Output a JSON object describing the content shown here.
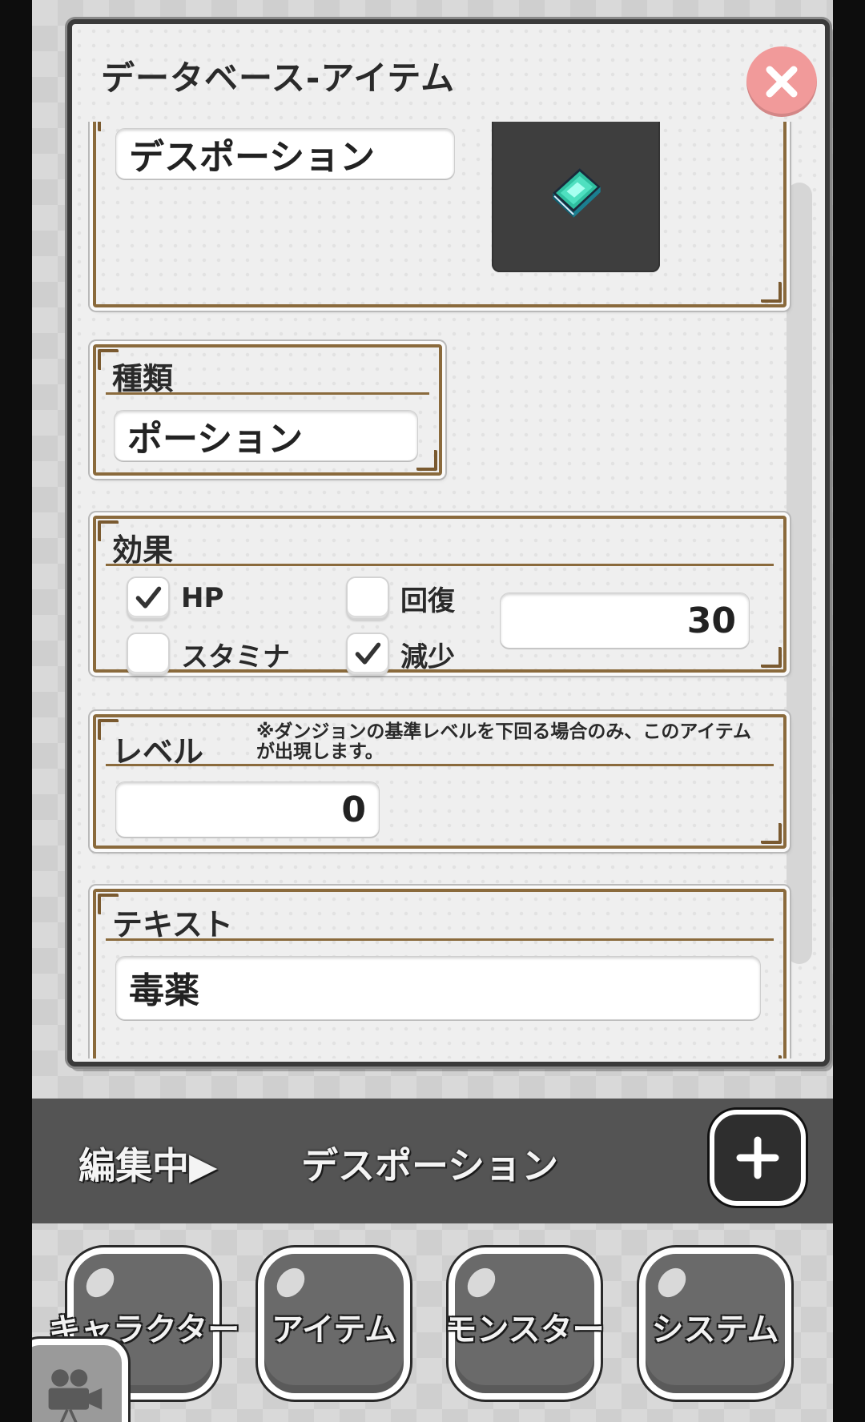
{
  "dialog": {
    "title": "データベース-アイテム"
  },
  "item": {
    "name": "デスポーション",
    "image_icon": "green-potion-book-icon"
  },
  "category": {
    "label": "種類",
    "value": "ポーション"
  },
  "effect": {
    "label": "効果",
    "options": {
      "hp": {
        "label": "HP",
        "checked": true
      },
      "stamina": {
        "label": "スタミナ",
        "checked": false
      },
      "recover": {
        "label": "回復",
        "checked": false
      },
      "decrease": {
        "label": "減少",
        "checked": true
      }
    },
    "amount": "30"
  },
  "level": {
    "label": "レベル",
    "note": "※ダンジョンの基準レベルを下回る場合のみ、このアイテムが出現します。",
    "value": "0"
  },
  "text": {
    "label": "テキスト",
    "value_partial": "毒薬"
  },
  "edit_bar": {
    "label": "編集中▶",
    "name": "デスポーション",
    "add_icon": "plus-icon"
  },
  "tabs": [
    {
      "label": "キャラクター"
    },
    {
      "label": "アイテム"
    },
    {
      "label": "モンスター"
    },
    {
      "label": "システム"
    }
  ],
  "colors": {
    "close_button": "#f19a9a",
    "panel_border": "#8a6a3c",
    "image_bg": "#3e3e3e",
    "edit_bar_bg": "#545454"
  }
}
